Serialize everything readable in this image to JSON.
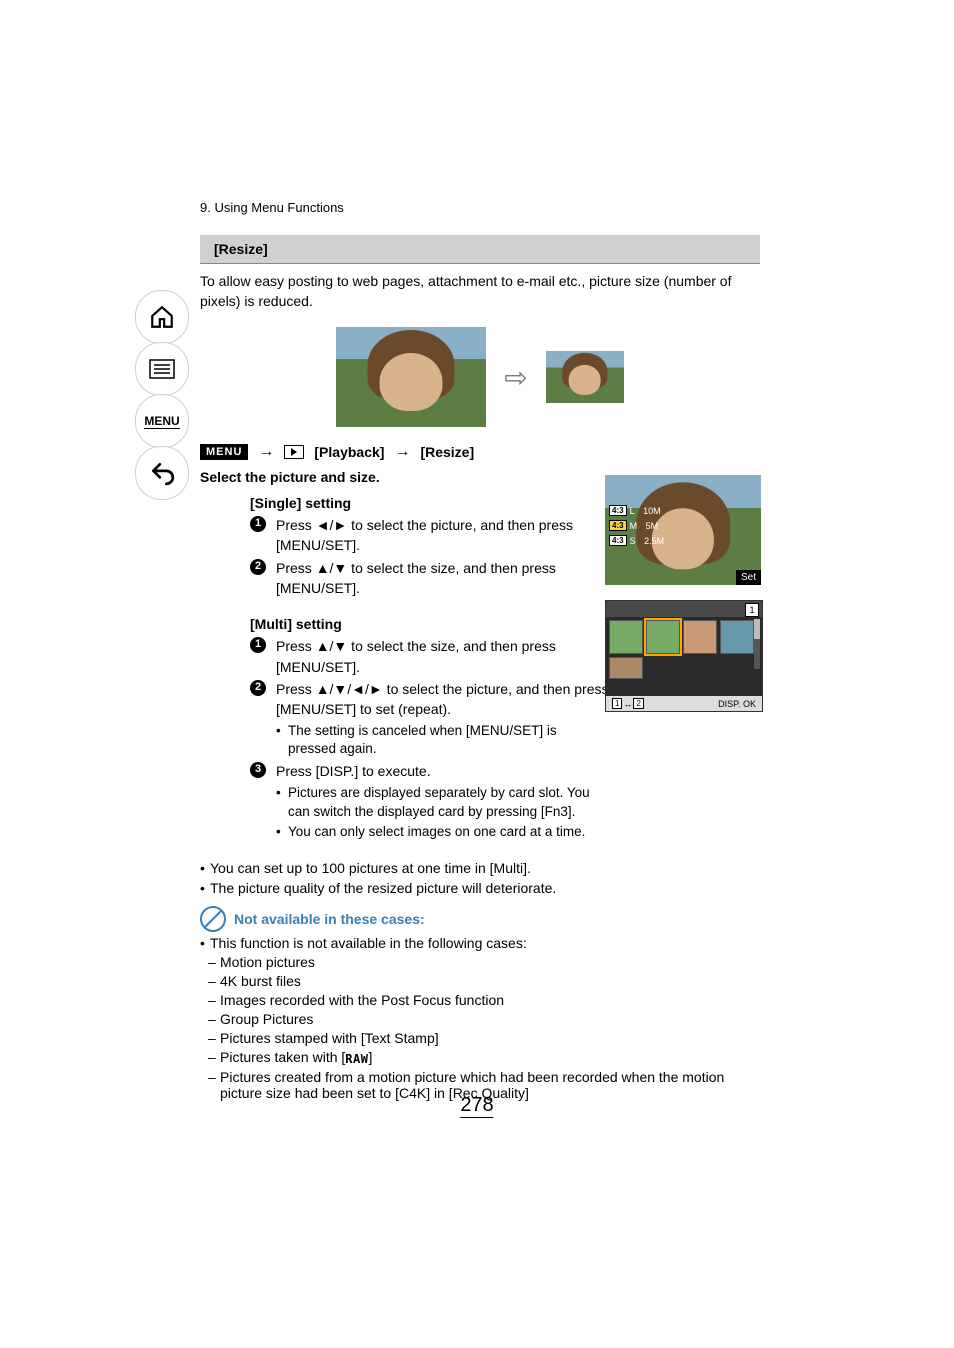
{
  "chapter": "9. Using Menu Functions",
  "section_title": "[Resize]",
  "intro": "To allow easy posting to web pages, attachment to e-mail etc., picture size (number of pixels) is reduced.",
  "menu_path": {
    "menu_label": "MENU",
    "crumb1": "[Playback]",
    "crumb2": "[Resize]"
  },
  "select_title": "Select the picture and size.",
  "single": {
    "heading": "[Single] setting",
    "step1_a": "Press ",
    "step1_arrows": "◄/►",
    "step1_b": " to select the picture, and then press [MENU/SET].",
    "step2_a": "Press ",
    "step2_arrows": "▲/▼",
    "step2_b": " to select the size, and then press [MENU/SET]."
  },
  "multi": {
    "heading": "[Multi] setting",
    "step1_a": "Press ",
    "step1_arrows": "▲/▼",
    "step1_b": " to select the size, and then press [MENU/SET].",
    "step2_a": "Press ",
    "step2_arrows": "▲/▼/◄/►",
    "step2_b": " to select the picture, and then press [MENU/SET] to set (repeat).",
    "step2_note": "The setting is canceled when [MENU/SET] is pressed again.",
    "step3": "Press [DISP.] to execute.",
    "step3_note1": "Pictures are displayed separately by card slot. You can switch the displayed card by pressing [Fn3].",
    "step3_note2": "You can only select images on one card at a time."
  },
  "shot1": {
    "ratio": "4:3",
    "size_l": "L",
    "size_l_val": "10M",
    "size_m": "M",
    "size_m_val": "5M",
    "size_s": "S",
    "size_s_val": "2.5M",
    "set": "Set"
  },
  "shot2": {
    "card": "1",
    "switch_1": "1",
    "switch_2": "2",
    "disp": "DISP.",
    "ok": "OK"
  },
  "notes": {
    "n1": "You can set up to 100 pictures at one time in [Multi].",
    "n2": "The picture quality of the resized picture will deteriorate."
  },
  "na": {
    "title": "Not available in these cases:",
    "intro": "This function is not available in the following cases:",
    "d1": "Motion pictures",
    "d2": "4K burst files",
    "d3": "Images recorded with the Post Focus function",
    "d4": "Group Pictures",
    "d5": "Pictures stamped with [Text Stamp]",
    "d6_a": "Pictures taken with [",
    "d6_raw": "RAW",
    "d6_b": "]",
    "d7": "Pictures created from a motion picture which had been recorded when the motion picture size had been set to [C4K] in [Rec Quality]"
  },
  "page_number": "278"
}
